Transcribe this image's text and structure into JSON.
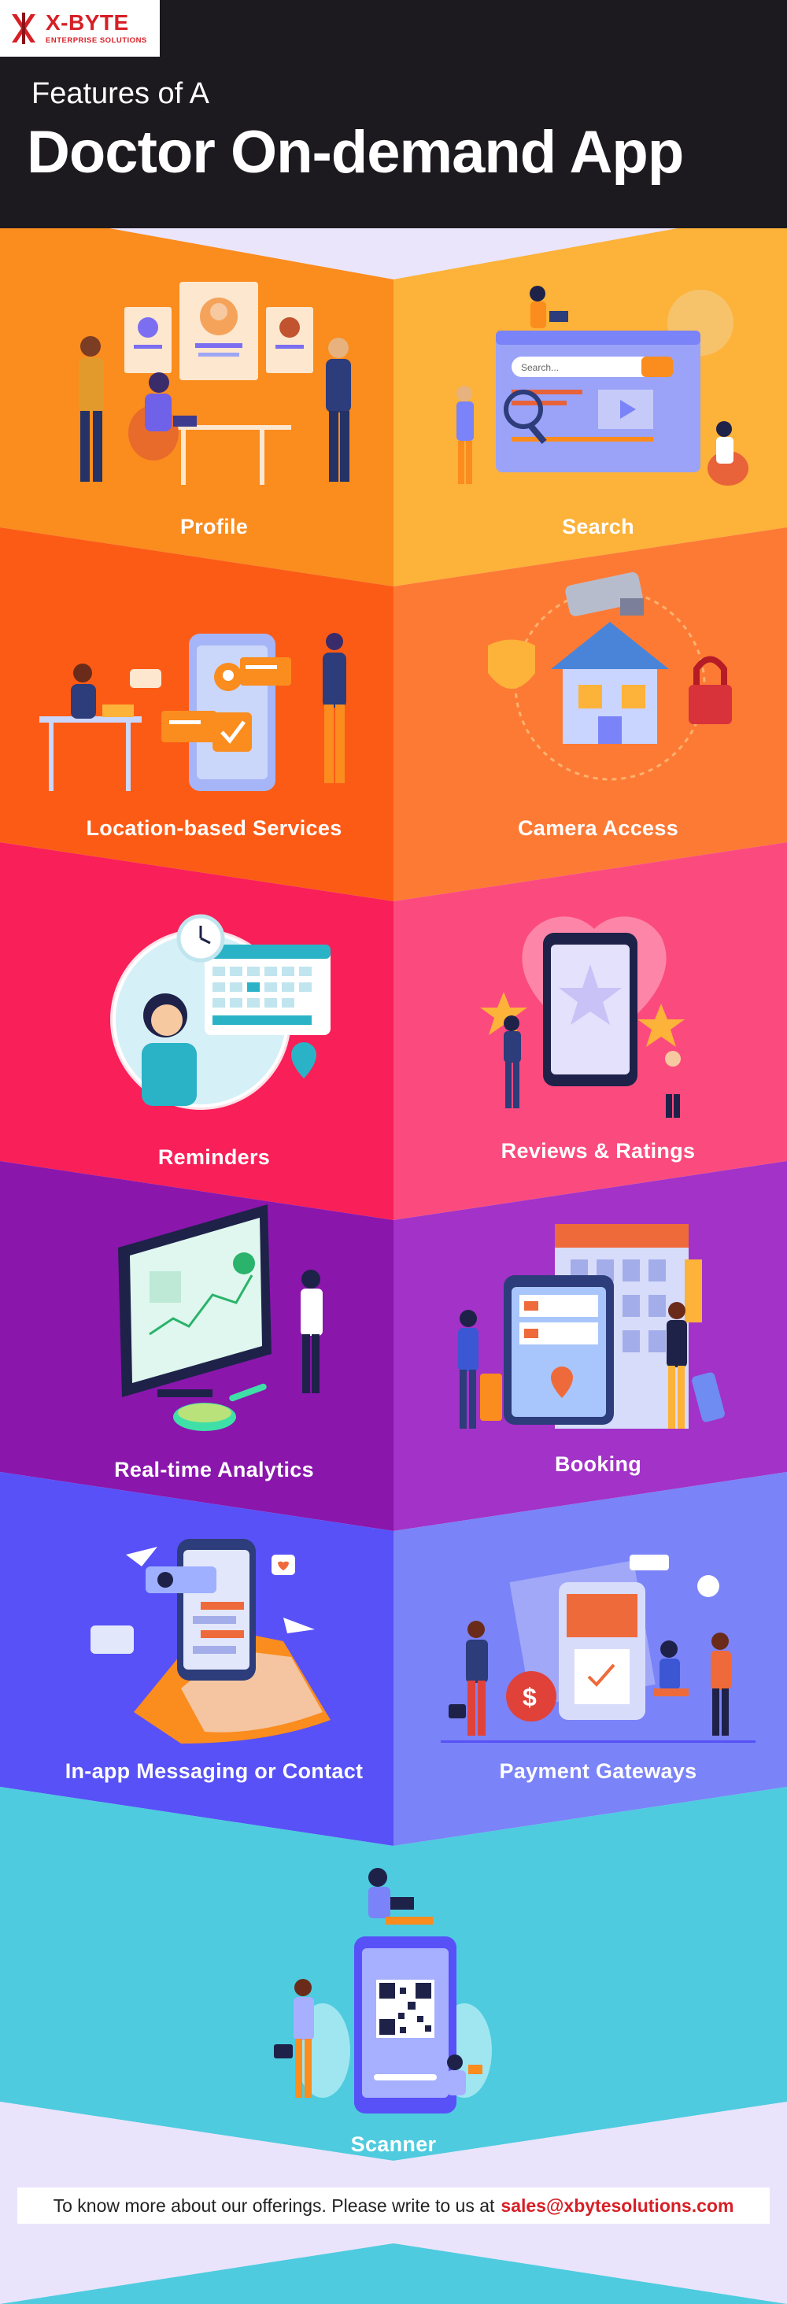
{
  "brand": {
    "name": "X-BYTE",
    "tagline": "ENTERPRISE SOLUTIONS",
    "red": "#d71f26"
  },
  "header": {
    "subtitle": "Features of A",
    "title": "Doctor On-demand App"
  },
  "features": [
    {
      "label": "Profile",
      "icon": "profile-cards-illustration",
      "color": "#fb8c1e"
    },
    {
      "label": "Search",
      "icon": "search-bar-illustration",
      "color": "#fdb239"
    },
    {
      "label": "Location-based Services",
      "icon": "map-pin-phone-illustration",
      "color": "#fc5b16"
    },
    {
      "label": "Camera Access",
      "icon": "security-camera-house-illustration",
      "color": "#fd7a35"
    },
    {
      "label": "Reminders",
      "icon": "calendar-clock-illustration",
      "color": "#f91f58"
    },
    {
      "label": "Reviews & Ratings",
      "icon": "phone-star-illustration",
      "color": "#fb4b7e"
    },
    {
      "label": "Real-time Analytics",
      "icon": "analytics-monitor-illustration",
      "color": "#8a16ac"
    },
    {
      "label": "Booking",
      "icon": "hotel-booking-illustration",
      "color": "#a232c8"
    },
    {
      "label": "In-app Messaging or Contact",
      "icon": "chat-phone-illustration",
      "color": "#5751f7"
    },
    {
      "label": "Payment Gateways",
      "icon": "payment-receipt-illustration",
      "color": "#7a83f7"
    },
    {
      "label": "Scanner",
      "icon": "qr-scanner-illustration",
      "color": "#4ecbdf"
    }
  ],
  "footer": {
    "text": "To know more about our offerings. Please write to us at",
    "email": "sales@xbytesolutions.com"
  }
}
